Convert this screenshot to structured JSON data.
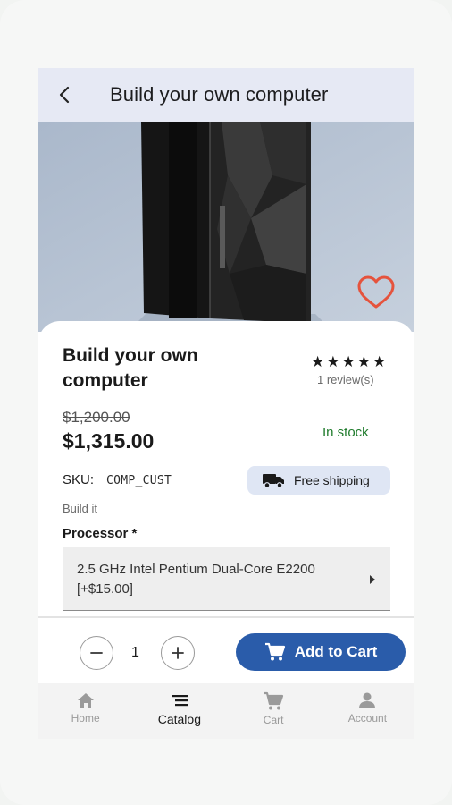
{
  "appbar": {
    "title": "Build your own computer",
    "back_icon": "arrow-back-icon"
  },
  "gallery": {
    "image": "ibm-server-photo",
    "slide_count": 2,
    "active_slide": 1,
    "favorite_icon": "heart-outline-icon",
    "favorite_color": "#e5533d"
  },
  "product": {
    "name": "Build your own computer",
    "rating_stars": "★★★★★",
    "rating": 5,
    "reviews": "1 review(s)",
    "old_price": "$1,200.00",
    "price": "$1,315.00",
    "stock": "In stock",
    "sku_label": "SKU:",
    "sku": "COMP_CUST",
    "shipping": "Free shipping",
    "short_description": "Build it"
  },
  "attribute": {
    "label": "Processor *",
    "value": "2.5 GHz Intel Pentium Dual-Core E2200 [+$15.00]"
  },
  "cart": {
    "quantity": "1",
    "add_label": "Add to Cart",
    "accent": "#2a5caa"
  },
  "nav": [
    {
      "label": "Home",
      "icon": "home-icon"
    },
    {
      "label": "Catalog",
      "icon": "catalog-icon",
      "active": true
    },
    {
      "label": "Cart",
      "icon": "cart-icon"
    },
    {
      "label": "Account",
      "icon": "account-icon"
    }
  ],
  "colors": {
    "stock": "#1e7b2b",
    "appbar": "#e6e9f4",
    "shipping_chip": "#dfe6f4"
  }
}
